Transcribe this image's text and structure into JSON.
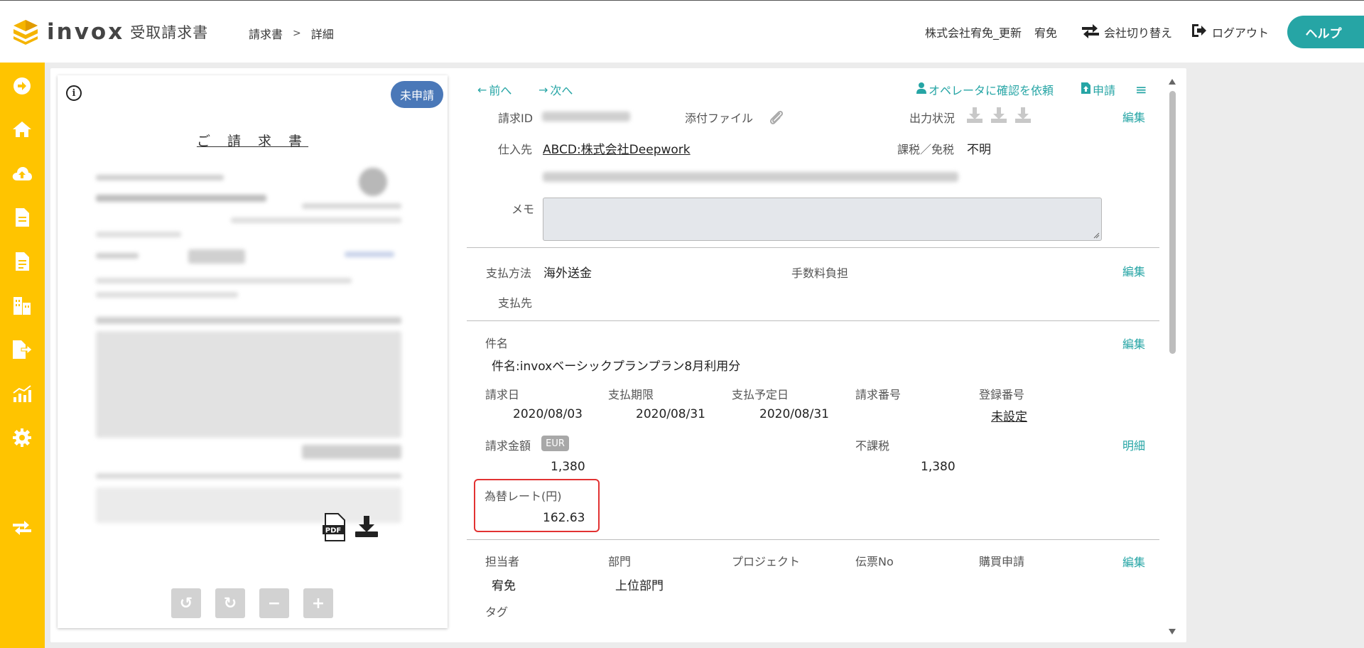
{
  "header": {
    "logo_text": "invox",
    "logo_sub": "受取請求書",
    "breadcrumb": [
      "請求書",
      "詳細"
    ],
    "company": "株式会社宥免_更新",
    "user": "宥免",
    "switch_company": "会社切り替え",
    "logout": "ログアウト",
    "help": "ヘルプ"
  },
  "sidebar": {
    "items": [
      "arrow-right-circle-icon",
      "home-icon",
      "cloud-upload-icon",
      "document-icon",
      "document-icon",
      "building-icon",
      "file-export-icon",
      "chart-icon",
      "gear-icon",
      "switch-icon"
    ]
  },
  "document": {
    "status": "未申請",
    "title": "ご 請 求 書",
    "pdf_label": "PDF"
  },
  "detail": {
    "nav": {
      "prev": "前へ",
      "next": "次へ",
      "request_confirm": "オペレータに確認を依頼",
      "apply": "申請"
    },
    "basic": {
      "invoice_id_label": "請求ID",
      "attachment_label": "添付ファイル",
      "output_status_label": "出力状況",
      "edit": "編集",
      "supplier_label": "仕入先",
      "supplier_value": "ABCD:株式会社Deepwork",
      "tax_label": "課税／免税",
      "tax_value": "不明",
      "memo_label": "メモ"
    },
    "payment": {
      "method_label": "支払方法",
      "method_value": "海外送金",
      "fee_label": "手数料負担",
      "payee_label": "支払先",
      "edit": "編集"
    },
    "invoice": {
      "subject_label": "件名",
      "subject_value": "件名:invoxベーシックプランプラン8月利用分",
      "edit": "編集",
      "columns": [
        {
          "label": "請求日",
          "value": "2020/08/03"
        },
        {
          "label": "支払期限",
          "value": "2020/08/31"
        },
        {
          "label": "支払予定日",
          "value": "2020/08/31"
        },
        {
          "label": "請求番号",
          "value": ""
        },
        {
          "label": "登録番号",
          "value": "未設定"
        }
      ],
      "amount_label": "請求金額",
      "currency": "EUR",
      "amount_value": "1,380",
      "non_taxable_label": "不課税",
      "non_taxable_value": "1,380",
      "breakdown": "明細",
      "rate_label": "為替レート(円)",
      "rate_value": "162.63"
    },
    "assignment": {
      "columns": [
        {
          "label": "担当者",
          "value": "宥免"
        },
        {
          "label": "部門",
          "value": "上位部門"
        },
        {
          "label": "プロジェクト",
          "value": ""
        },
        {
          "label": "伝票No",
          "value": ""
        },
        {
          "label": "購買申請",
          "value": ""
        }
      ],
      "tag_label": "タグ",
      "edit": "編集"
    }
  }
}
